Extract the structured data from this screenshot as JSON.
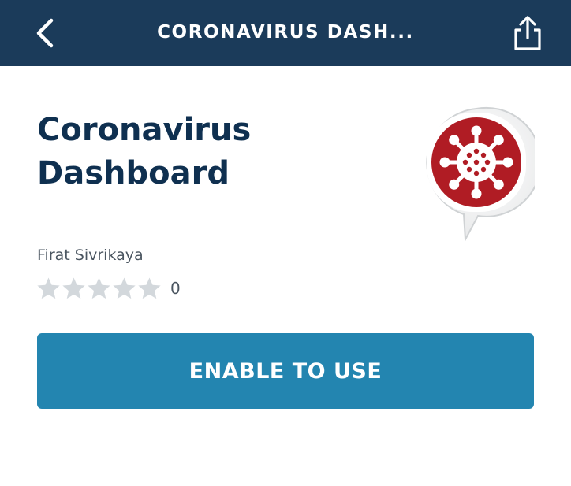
{
  "header": {
    "title": "CORONAVIRUS DASH...",
    "back_icon": "chevron-left-icon",
    "share_icon": "share-icon"
  },
  "skill": {
    "title": "Coronavirus Dashboard",
    "author": "Firat Sivrikaya",
    "rating_count": "0",
    "stars_filled": 0,
    "stars_total": 5,
    "icon": "coronavirus-icon"
  },
  "actions": {
    "enable_label": "ENABLE TO USE"
  },
  "colors": {
    "header_bg": "#1b3b5a",
    "title_text": "#0f3050",
    "button_bg": "#2385b0",
    "icon_red": "#b01c24",
    "star_empty": "#d3d8dc"
  }
}
